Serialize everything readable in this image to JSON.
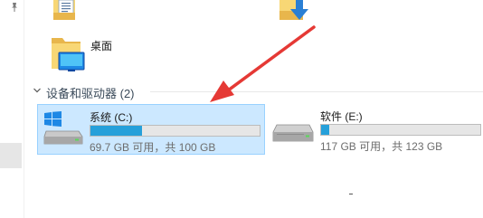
{
  "desktop_folder": {
    "label": "桌面",
    "icon": "desktop-folder-icon"
  },
  "drives_group": {
    "title": "设备和驱动器 (2)",
    "collapse_icon": "chevron-down-icon"
  },
  "drives": [
    {
      "name": "系统 (C:)",
      "free_text": "69.7 GB 可用，共 100 GB",
      "used_fraction": 0.303,
      "selected": true,
      "icon": "windows-drive-icon"
    },
    {
      "name": "软件 (E:)",
      "free_text": "117 GB 可用，共 123 GB",
      "used_fraction": 0.049,
      "selected": false,
      "icon": "hard-drive-icon"
    }
  ],
  "colors": {
    "selection_bg": "#cce8ff",
    "selection_border": "#99d1ff",
    "usage_fill": "#26a0da",
    "annotation_arrow": "#e53935"
  },
  "icons": {
    "pin": "pin-icon",
    "top_folder_1": "documents-folder-icon",
    "top_folder_2": "downloads-folder-icon"
  }
}
